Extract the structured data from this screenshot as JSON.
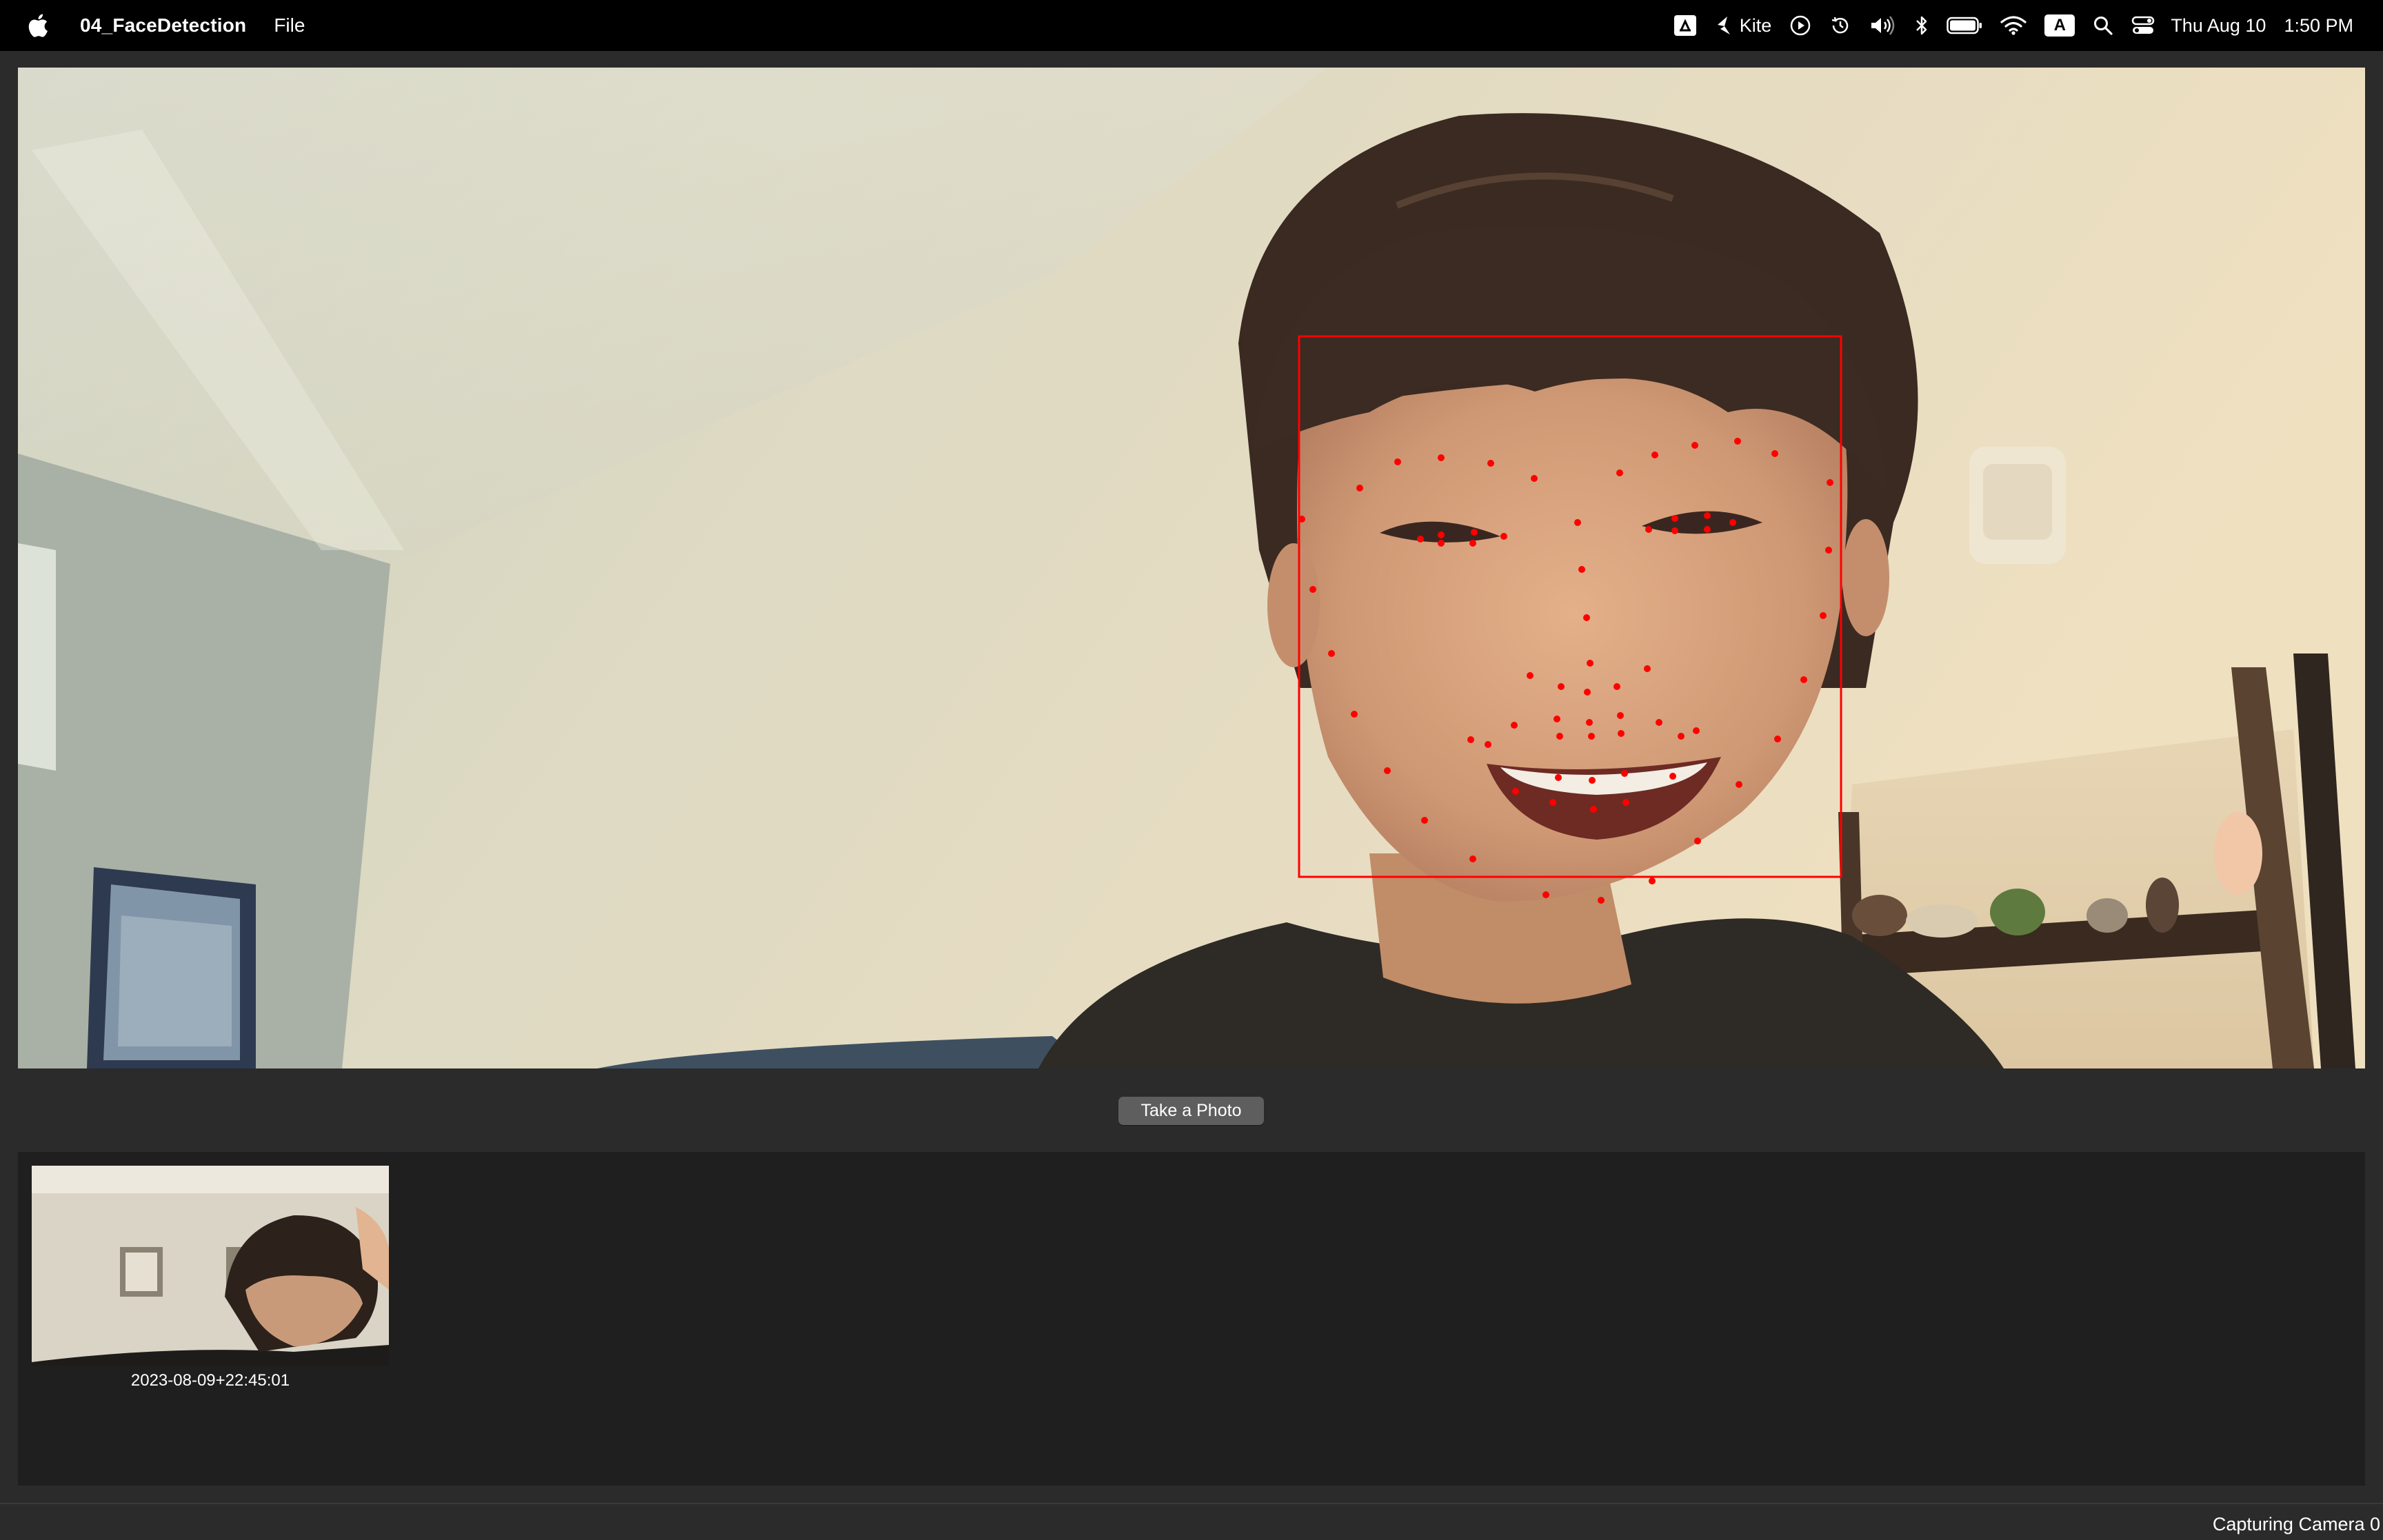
{
  "menubar": {
    "app_name": "04_FaceDetection",
    "menus": [
      "File"
    ],
    "status_items": [
      {
        "icon": "google-drive-icon"
      },
      {
        "icon": "kite-icon",
        "label": "Kite"
      },
      {
        "icon": "play-circle-icon"
      },
      {
        "icon": "time-machine-icon"
      },
      {
        "icon": "volume-icon"
      },
      {
        "icon": "bluetooth-icon"
      },
      {
        "icon": "battery-icon"
      },
      {
        "icon": "wifi-icon"
      },
      {
        "icon": "input-source-icon",
        "label": "A"
      },
      {
        "icon": "spotlight-search-icon"
      },
      {
        "icon": "control-center-icon"
      }
    ],
    "date": "Thu Aug 10",
    "time": "1:50 PM"
  },
  "camera": {
    "face_box_color": "#ff0000",
    "landmark_color": "#ff0000"
  },
  "controls": {
    "take_photo_label": "Take a Photo"
  },
  "gallery": {
    "photos": [
      {
        "label": "2023-08-09+22:45:01"
      }
    ]
  },
  "status": {
    "text": "Capturing Camera 0"
  }
}
